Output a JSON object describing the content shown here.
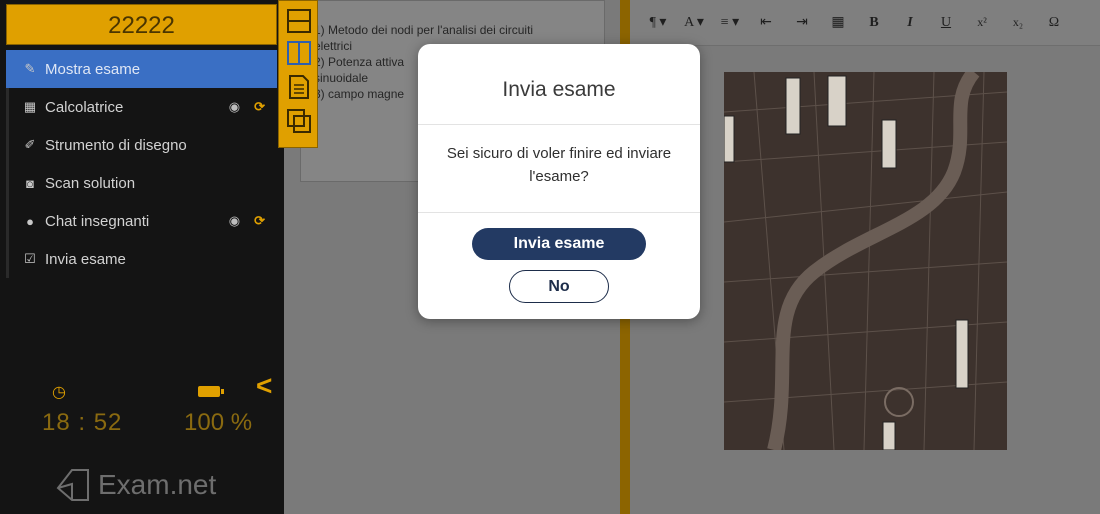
{
  "sidebar": {
    "exam_code": "22222",
    "items": [
      {
        "label": "Mostra esame",
        "icon": "edit-icon",
        "active": true
      },
      {
        "label": "Calcolatrice",
        "icon": "calculator-icon",
        "controls": true
      },
      {
        "label": "Strumento di disegno",
        "icon": "brush-icon"
      },
      {
        "label": "Scan solution",
        "icon": "camera-icon"
      },
      {
        "label": "Chat insegnanti",
        "icon": "chat-icon",
        "controls": true
      },
      {
        "label": "Invia esame",
        "icon": "checkbox-icon"
      }
    ],
    "status": {
      "time": "18 : 52",
      "battery": "100 %"
    },
    "logo_text": "Exam.net"
  },
  "tool_strip": {
    "icons": [
      "split-horizontal-icon",
      "split-vertical-icon",
      "document-icon",
      "copy-icon"
    ]
  },
  "document": {
    "lines": [
      "1) Metodo dei nodi per l'analisi dei circuiti",
      "elettrici",
      "2) Potenza attiva",
      "sinuoidale",
      "3) campo magne"
    ]
  },
  "editor_toolbar": {
    "items": [
      "¶ ▾",
      "A ▾",
      "≡ ▾",
      "⇤",
      "⇥",
      "▦",
      "B",
      "I",
      "U",
      "x²",
      "x₂",
      "Ω"
    ]
  },
  "modal": {
    "title": "Invia esame",
    "message": "Sei sicuro di voler finire ed inviare l'esame?",
    "confirm_label": "Invia esame",
    "cancel_label": "No"
  },
  "colors": {
    "accent": "#e0a000",
    "active_item": "#3a6fc4",
    "primary_button": "#233a63"
  }
}
